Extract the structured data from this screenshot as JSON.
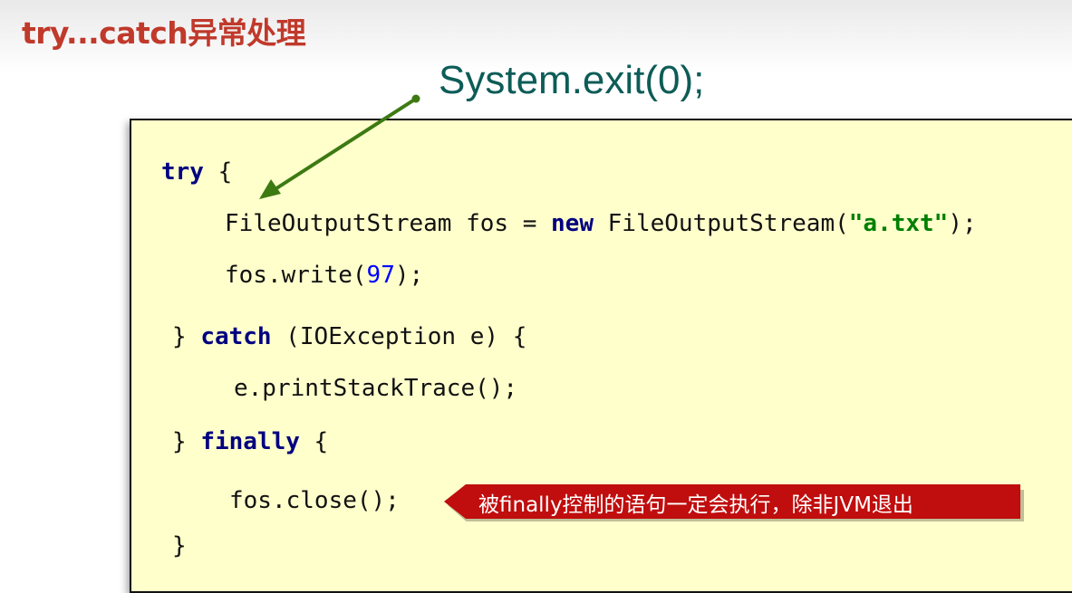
{
  "slide": {
    "title": "try...catch异常处理"
  },
  "annotation": {
    "exit_call": "System.exit(0);",
    "callout_text": "被finally控制的语句一定会执行，除非JVM退出"
  },
  "code": {
    "line1": {
      "kw": "try",
      "rest": " {"
    },
    "line2": {
      "a": "FileOutputStream fos = ",
      "kw": "new",
      "b": " FileOutputStream(",
      "str": "\"a.txt\"",
      "c": ");"
    },
    "line3": {
      "a": "fos.write(",
      "num": "97",
      "b": ");"
    },
    "line4": {
      "a": "} ",
      "kw": "catch",
      "b": " (IOException e) {"
    },
    "line5": {
      "a": "e.printStackTrace();"
    },
    "line6": {
      "a": "} ",
      "kw": "finally",
      "b": " {"
    },
    "line7": {
      "a": "fos.close();"
    },
    "line8": {
      "a": "}"
    }
  },
  "colors": {
    "title": "#c0392b",
    "exit_call": "#0d5c57",
    "arrow": "#3d7a12",
    "panel_bg": "#ffffcc",
    "keyword": "#000080",
    "string": "#008000",
    "number": "#0000ff",
    "callout_bg": "#c00d0d"
  }
}
